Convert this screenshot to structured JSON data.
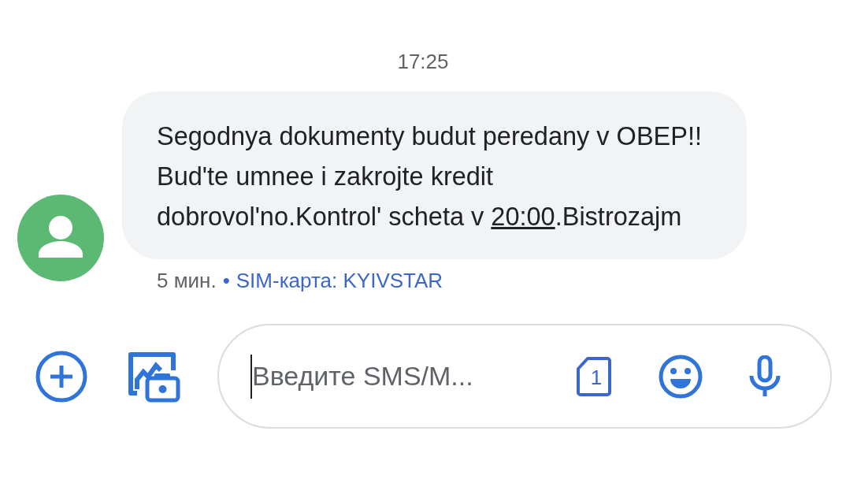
{
  "timestamp": "17:25",
  "message": {
    "segments": [
      {
        "kind": "text",
        "text": "Segodnya dokumenty budut peredany v OBEP!! Bud'te umnee i zakrojte kredit dobrovol'no.Kontrol' scheta v "
      },
      {
        "kind": "link",
        "text": "20:00"
      },
      {
        "kind": "text",
        "text": ".Bistrozajm"
      }
    ],
    "age": "5 мин.",
    "separator": "•",
    "sim": "SIM-карта: KYIVSTAR"
  },
  "composer": {
    "placeholder": "Введите SMS/M...",
    "sim_slot": "1"
  }
}
